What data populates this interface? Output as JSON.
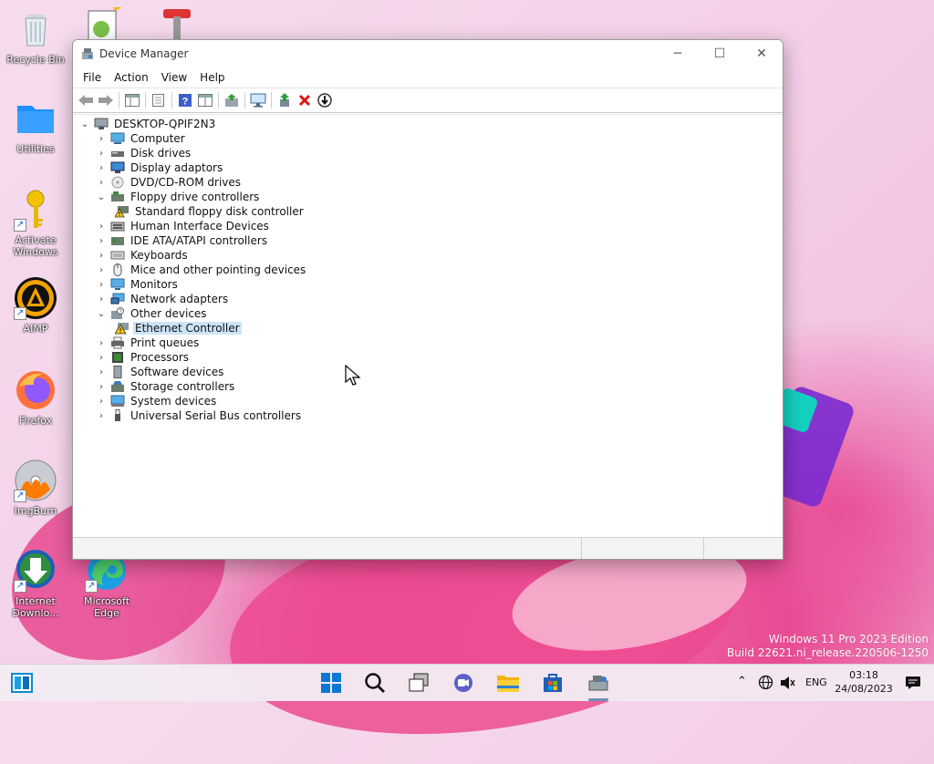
{
  "desktop": {
    "icons": [
      {
        "label": "Recycle Bin",
        "icon": "recycle-bin-icon"
      },
      {
        "label": "Utilities",
        "icon": "folder-icon"
      },
      {
        "label": "Activate Windows",
        "icon": "key-icon"
      },
      {
        "label": "AIMP",
        "icon": "aimp-icon"
      },
      {
        "label": "Firefox",
        "icon": "firefox-icon"
      },
      {
        "label": "ImgBurn",
        "icon": "imgburn-icon"
      },
      {
        "label": "Internet Downlo...",
        "icon": "idm-icon"
      },
      {
        "label": "Microsoft Edge",
        "icon": "edge-icon"
      }
    ],
    "watermark": {
      "line1": "Windows 11 Pro 2023 Edition",
      "line2": "Build 22621.ni_release.220506-1250"
    }
  },
  "window": {
    "title": "Device Manager",
    "controls": {
      "minimize": "─",
      "maximize": "☐",
      "close": "✕"
    },
    "menu": [
      "File",
      "Action",
      "View",
      "Help"
    ],
    "toolbar": [
      "back-arrow-icon",
      "forward-arrow-icon",
      "show-hide-console-tree-icon",
      "properties-icon",
      "help-icon",
      "view-icon",
      "scan-hardware-icon",
      "monitor-icon",
      "update-driver-icon",
      "uninstall-icon",
      "disable-device-icon"
    ],
    "tree": {
      "root": "DESKTOP-QPIF2N3",
      "items": [
        {
          "label": "Computer",
          "expanded": false
        },
        {
          "label": "Disk drives",
          "expanded": false
        },
        {
          "label": "Display adaptors",
          "expanded": false
        },
        {
          "label": "DVD/CD-ROM drives",
          "expanded": false
        },
        {
          "label": "Floppy drive controllers",
          "expanded": true,
          "children": [
            "Standard floppy disk controller"
          ]
        },
        {
          "label": "Human Interface Devices",
          "expanded": false
        },
        {
          "label": "IDE ATA/ATAPI controllers",
          "expanded": false
        },
        {
          "label": "Keyboards",
          "expanded": false
        },
        {
          "label": "Mice and other pointing devices",
          "expanded": false
        },
        {
          "label": "Monitors",
          "expanded": false
        },
        {
          "label": "Network adapters",
          "expanded": false
        },
        {
          "label": "Other devices",
          "expanded": true,
          "children": [
            "Ethernet Controller"
          ]
        },
        {
          "label": "Print queues",
          "expanded": false
        },
        {
          "label": "Processors",
          "expanded": false
        },
        {
          "label": "Software devices",
          "expanded": false
        },
        {
          "label": "Storage controllers",
          "expanded": false
        },
        {
          "label": "System devices",
          "expanded": false
        },
        {
          "label": "Universal Serial Bus controllers",
          "expanded": false
        }
      ],
      "selected": "Ethernet Controller"
    }
  },
  "taskbar": {
    "apps": [
      "start-icon",
      "search-icon",
      "task-view-icon",
      "chat-icon",
      "file-explorer-icon",
      "store-icon",
      "device-manager-icon"
    ],
    "language": "ENG",
    "time": "03:18",
    "date": "24/08/2023"
  },
  "colors": {
    "accent": "#0067c0",
    "selection": "#cce4f7",
    "warning": "#f5c518"
  }
}
